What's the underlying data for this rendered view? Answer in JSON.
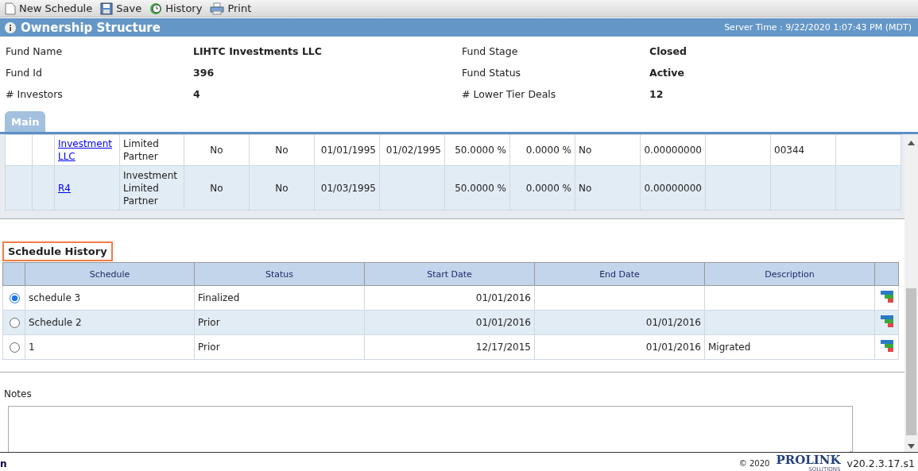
{
  "toolbar": [
    {
      "kind": "new",
      "label": "New Schedule"
    },
    {
      "kind": "save",
      "label": "Save"
    },
    {
      "kind": "history",
      "label": "History"
    },
    {
      "kind": "print",
      "label": "Print"
    }
  ],
  "header": {
    "title": "Ownership Structure",
    "server_time": "Server Time : 9/22/2020 1:07:43 PM (MDT)"
  },
  "fund_info": [
    {
      "label": "Fund Name",
      "value": "LIHTC Investments LLC"
    },
    {
      "label": "Fund Stage",
      "value": "Closed"
    },
    {
      "label": "Fund Id",
      "value": "396"
    },
    {
      "label": "Fund Status",
      "value": "Active"
    },
    {
      "label": "# Investors",
      "value": "4"
    },
    {
      "label": "# Lower Tier Deals",
      "value": "12"
    }
  ],
  "tabs": [
    {
      "label": "Main",
      "selected": true
    }
  ],
  "investors_table": {
    "rows": [
      {
        "cells": [
          "",
          "",
          {
            "link": [
              "Investment",
              "LLC"
            ]
          },
          [
            "Limited",
            "Partner"
          ],
          "No",
          "No",
          "01/01/1995",
          "01/02/1995",
          "50.0000 %",
          "0.0000 %",
          "No",
          "0.00000000",
          "",
          "00344",
          ""
        ]
      },
      {
        "cells": [
          "",
          "",
          {
            "link": [
              "R4"
            ]
          },
          [
            "Investment",
            "Limited",
            "Partner"
          ],
          "No",
          "No",
          "01/03/1995",
          "",
          "50.0000 %",
          "0.0000 %",
          "No",
          "0.00000000",
          "",
          "",
          ""
        ]
      }
    ]
  },
  "schedule_history": {
    "title": "Schedule History",
    "columns": [
      "Schedule",
      "Status",
      "Start Date",
      "End Date",
      "Description"
    ],
    "rows": [
      {
        "selected": true,
        "schedule": "schedule 3",
        "status": "Finalized",
        "start_date": "01/01/2016",
        "end_date": "",
        "description": ""
      },
      {
        "selected": false,
        "schedule": "Schedule 2",
        "status": "Prior",
        "start_date": "01/01/2016",
        "end_date": "01/01/2016",
        "description": ""
      },
      {
        "selected": false,
        "schedule": "1",
        "status": "Prior",
        "start_date": "12/17/2015",
        "end_date": "01/01/2016",
        "description": "Migrated"
      }
    ]
  },
  "notes": {
    "label": "Notes"
  },
  "footer": {
    "left": "n",
    "copyright": "© 2020",
    "logo": "PROLINK",
    "logo_sub": "SOLUTIONS",
    "version": "v20.2.3.17.s1"
  }
}
